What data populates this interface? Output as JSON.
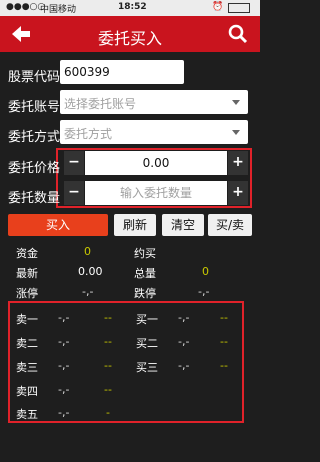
{
  "status_bar": {
    "carrier": "中国移动",
    "time": "18:52"
  },
  "header": {
    "title": "委托买入"
  },
  "form": {
    "stock_code_label": "股票代码",
    "stock_code_value": "600399",
    "account_label": "委托账号",
    "account_placeholder": "选择委托账号",
    "method_label": "委托方式",
    "method_placeholder": "委托方式",
    "price_label": "委托价格",
    "price_value": "0.00",
    "quantity_label": "委托数量",
    "quantity_placeholder": "输入委托数量",
    "minus": "−",
    "plus": "+"
  },
  "actions": {
    "buy": "买入",
    "refresh": "刷新",
    "clear": "清空",
    "buy_sell": "买/卖"
  },
  "info": {
    "funds_label": "资金",
    "funds_value": "0",
    "approx_buy_label": "约买",
    "latest_label": "最新",
    "latest_value": "0.00",
    "total_label": "总量",
    "total_value": "0",
    "limit_up_label": "涨停",
    "limit_up_value": "-,-",
    "limit_down_label": "跌停",
    "limit_down_value": "-,-"
  },
  "orderbook": {
    "sell": [
      {
        "label": "卖一",
        "price": "-,-",
        "vol": "--"
      },
      {
        "label": "卖二",
        "price": "-,-",
        "vol": "--"
      },
      {
        "label": "卖三",
        "price": "-,-",
        "vol": "--"
      },
      {
        "label": "卖四",
        "price": "-,-",
        "vol": "--"
      },
      {
        "label": "卖五",
        "price": "-,-",
        "vol": "-"
      }
    ],
    "buy": [
      {
        "label": "买一",
        "price": "-,-",
        "vol": "--"
      },
      {
        "label": "买二",
        "price": "-,-",
        "vol": "--"
      },
      {
        "label": "买三",
        "price": "-,-",
        "vol": "--"
      }
    ]
  },
  "colors": {
    "accent": "#c9141e",
    "buy_button": "#e8401c",
    "highlight_box": "#e0222a",
    "value_yellow": "#c8c800"
  }
}
